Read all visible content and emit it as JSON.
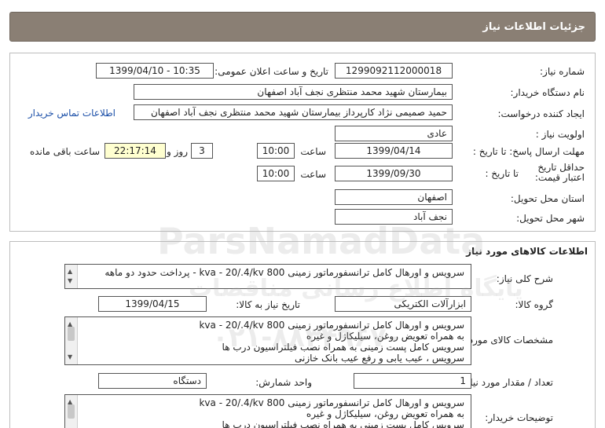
{
  "header": {
    "title": "جزئیات اطلاعات نیاز"
  },
  "info": {
    "need_number_label": "شماره نیاز:",
    "need_number": "1299092112000018",
    "announce_label": "تاریخ و ساعت اعلان عمومی:",
    "announce_value": "1399/04/10 - 10:35",
    "buyer_label": "نام دستگاه خریدار:",
    "buyer_value": "بیمارستان شهید محمد منتظری نجف آباد اصفهان",
    "creator_label": "ایجاد کننده درخواست:",
    "creator_value": "حمید صمیمی نژاد کارپرداز بیمارستان شهید محمد منتظری نجف آباد اصفهان",
    "contact_link": "اطلاعات تماس خریدار",
    "priority_label": "اولویت نیاز :",
    "priority_value": "عادی",
    "deadline_label": "مهلت ارسال پاسخ: تا تاریخ :",
    "deadline_date": "1399/04/14",
    "time_label": "ساعت",
    "deadline_time": "10:00",
    "days_value": "3",
    "days_label": "روز و",
    "remaining_time": "22:17:14",
    "remaining_label": "ساعت باقی مانده",
    "validity_label": "حداقل تاریخ اعتبار قیمت:",
    "validity_to_label": "تا تاریخ :",
    "validity_date": "1399/09/30",
    "validity_time_label": "ساعت",
    "validity_time": "10:00",
    "province_label": "استان محل تحویل:",
    "province_value": "اصفهان",
    "city_label": "شهر محل تحویل:",
    "city_value": "نجف آباد"
  },
  "goods": {
    "section_title": "اطلاعات کالاهای مورد نیاز",
    "desc_label": "شرح کلی نیاز:",
    "desc_value": "سرویس و اورهال کامل ترانسفورماتور زمینی kva - 20/.4/kv 800 - پرداخت حدود دو ماهه",
    "group_label": "گروه کالا:",
    "group_value": "ابزارآلات الکتریکی",
    "need_date_label": "تاریخ نیاز به کالا:",
    "need_date": "1399/04/15",
    "specs_label": "مشخصات کالای مورد نیاز:",
    "specs_lines": [
      "سرویس و اورهال کامل ترانسفورماتور زمینی kva - 20/.4/kv 800",
      "به همراه تعویض روغن، سیلیکاژل و غیره",
      "سرویس کامل پست زمینی به همراه نصب فیلتراسیون درب ها",
      "سرویس ، عیب یابی و رفع عیب بانک خازنی"
    ],
    "qty_label": "تعداد / مقدار مورد نیاز:",
    "qty_value": "1",
    "unit_label": "واحد شمارش:",
    "unit_value": "دستگاه",
    "notes_label": "توضیحات خریدار:",
    "notes_lines": [
      "سرویس و اورهال کامل ترانسفورماتور زمینی kva - 20/.4/kv 800",
      "به همراه تعویض روغن، سیلیکاژل و غیره",
      "سرویس کامل پست زمینی به همراه نصب فیلتراسیون درب ها"
    ]
  },
  "watermark": {
    "brand": "ParsNamadData",
    "tagline": "پایگاه اطلاع رسانی مناقصات",
    "phone": "۰۲۱-۸۸۳۴۹۶۷۰"
  }
}
